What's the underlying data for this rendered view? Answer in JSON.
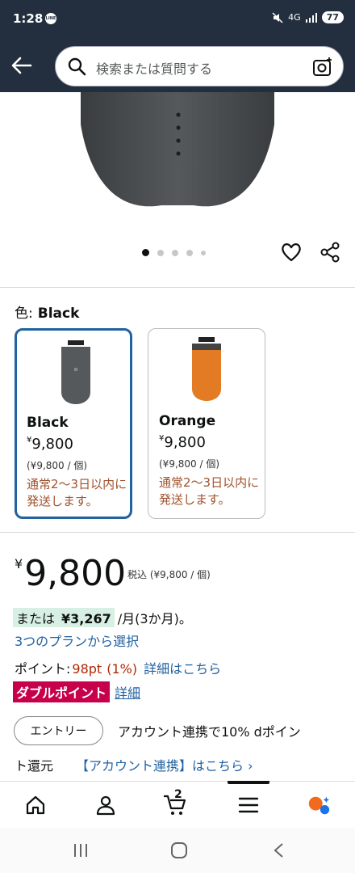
{
  "status_bar": {
    "time": "1:28",
    "line_badge": "LINE",
    "network": "4G",
    "battery": "77"
  },
  "search": {
    "placeholder": "検索または質問する"
  },
  "gallery": {
    "dots": 5,
    "active_index": 0
  },
  "color": {
    "label": "色:",
    "selected": "Black"
  },
  "variants": [
    {
      "name": "Black",
      "currency": "¥",
      "price": "9,800",
      "unit_price": "(¥9,800 / 個)",
      "shipping": "通常2～3日以内に発送します。",
      "color": "#4a4d4f"
    },
    {
      "name": "Orange",
      "currency": "¥",
      "price": "9,800",
      "unit_price": "(¥9,800 / 個)",
      "shipping": "通常2～3日以内に発送します。",
      "color": "#e27b24"
    }
  ],
  "price": {
    "currency": "¥",
    "amount": "9,800",
    "tax_note": "税込 (¥9,800 / 個)"
  },
  "installment": {
    "or_label": "または",
    "amount": "¥3,267",
    "suffix": "/月(3か月)。",
    "link": "3つのプランから選択"
  },
  "points": {
    "label": "ポイント:",
    "value": "98pt",
    "percent": "(1%)",
    "details_link": "詳細はこちら"
  },
  "double_point": {
    "badge": "ダブルポイント",
    "link": "詳細"
  },
  "account_link": {
    "entry_button": "エントリー",
    "text1": "アカウント連携で10% dポイン",
    "text2": "ト還元",
    "link": "【アカウント連携】はこちら ›"
  },
  "bottom_nav": {
    "cart_count": "2"
  },
  "colors": {
    "header_bg": "#232f3e",
    "link": "#2162a1",
    "selected_border": "#2162a1",
    "points_red": "#b12704",
    "badge": "#c7004c",
    "installment_bg": "#d7f0e3"
  }
}
